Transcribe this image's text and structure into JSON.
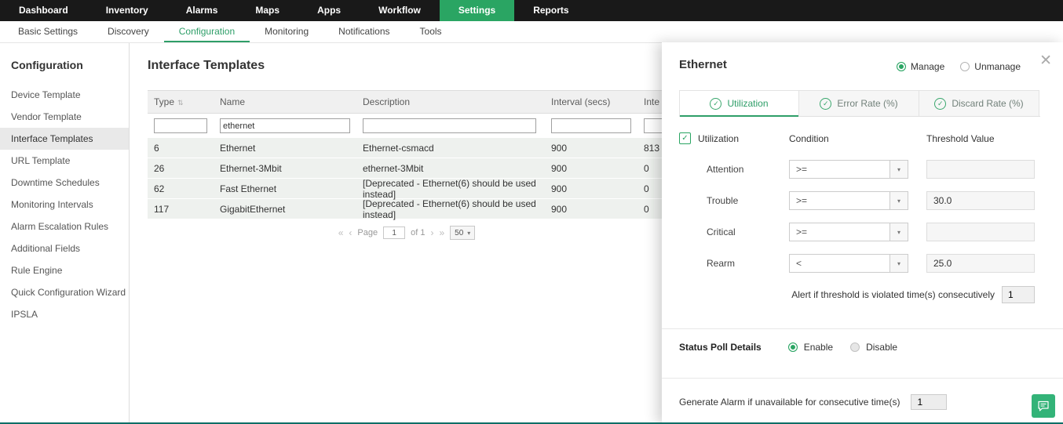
{
  "topnav": {
    "items": [
      "Dashboard",
      "Inventory",
      "Alarms",
      "Maps",
      "Apps",
      "Workflow",
      "Settings",
      "Reports"
    ]
  },
  "subnav": {
    "items": [
      "Basic Settings",
      "Discovery",
      "Configuration",
      "Monitoring",
      "Notifications",
      "Tools"
    ]
  },
  "sidebar": {
    "title": "Configuration",
    "items": [
      "Device Template",
      "Vendor Template",
      "Interface Templates",
      "URL Template",
      "Downtime Schedules",
      "Monitoring Intervals",
      "Alarm Escalation Rules",
      "Additional Fields",
      "Rule Engine",
      "Quick Configuration Wizard",
      "IPSLA"
    ]
  },
  "main": {
    "title": "Interface Templates",
    "table": {
      "columns": [
        "Type",
        "Name",
        "Description",
        "Interval (secs)",
        "Inte"
      ],
      "filters": {
        "type": "",
        "name": "ethernet",
        "description": "",
        "interval": "",
        "extra": ""
      },
      "rows": [
        {
          "type": "6",
          "name": "Ethernet",
          "description": "Ethernet-csmacd",
          "interval": "900",
          "extra": "813"
        },
        {
          "type": "26",
          "name": "Ethernet-3Mbit",
          "description": "ethernet-3Mbit",
          "interval": "900",
          "extra": "0"
        },
        {
          "type": "62",
          "name": "Fast Ethernet",
          "description": "[Deprecated - Ethernet(6) should be used instead]",
          "interval": "900",
          "extra": "0"
        },
        {
          "type": "117",
          "name": "GigabitEthernet",
          "description": "[Deprecated - Ethernet(6) should be used instead]",
          "interval": "900",
          "extra": "0"
        }
      ],
      "pagination": {
        "page_label": "Page",
        "page_value": "1",
        "of_label": "of 1",
        "size_value": "50"
      }
    }
  },
  "panel": {
    "title": "Ethernet",
    "manage_label": "Manage",
    "unmanage_label": "Unmanage",
    "tabs": [
      {
        "label": "Utilization"
      },
      {
        "label": "Error Rate (%)"
      },
      {
        "label": "Discard Rate (%)"
      }
    ],
    "metric": {
      "checkbox_label": "Utilization",
      "condition_header": "Condition",
      "threshold_header": "Threshold Value",
      "rows": [
        {
          "label": "Attention",
          "condition": ">=",
          "value": ""
        },
        {
          "label": "Trouble",
          "condition": ">=",
          "value": "30.0"
        },
        {
          "label": "Critical",
          "condition": ">=",
          "value": ""
        },
        {
          "label": "Rearm",
          "condition": "<",
          "value": "25.0"
        }
      ],
      "alert_text": "Alert if threshold is violated time(s) consecutively",
      "alert_value": "1"
    },
    "status_poll": {
      "label": "Status Poll Details",
      "enable_label": "Enable",
      "disable_label": "Disable"
    },
    "generate_alarm": {
      "label": "Generate Alarm if unavailable for consecutive time(s)",
      "value": "1"
    }
  },
  "icons": {
    "check": "✓",
    "caret_down": "▾",
    "close": "✕",
    "sort": "⇅",
    "first": "«",
    "prev": "‹",
    "next": "›",
    "last": "»"
  },
  "colors": {
    "accent_green": "#2aa563",
    "nav_dark": "#191919",
    "row_bg": "#eef1ee"
  }
}
